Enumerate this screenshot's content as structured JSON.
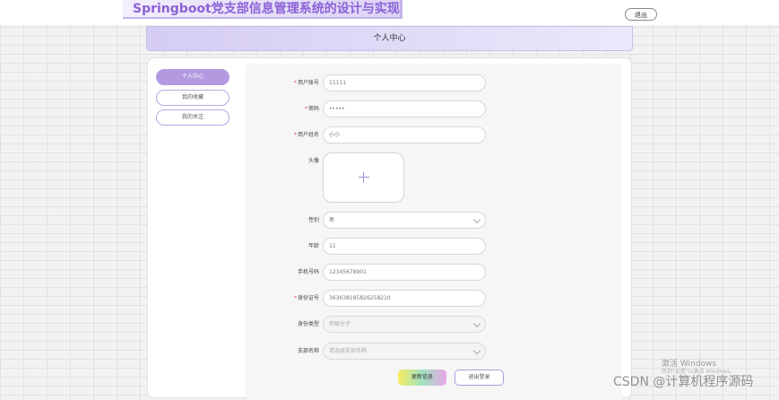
{
  "app": {
    "title": "Springboot党支部信息管理系统的设计与实现",
    "logout": "退出"
  },
  "page": {
    "title": "个人中心"
  },
  "menu": {
    "items": [
      {
        "label": "个人中心",
        "active": true
      },
      {
        "label": "我的收藏",
        "active": false
      },
      {
        "label": "我的关注",
        "active": false
      }
    ]
  },
  "form": {
    "username": {
      "label": "用户账号",
      "required": true,
      "value": "11111"
    },
    "password": {
      "label": "密码",
      "required": true,
      "value": "•••••"
    },
    "fullname": {
      "label": "用户姓名",
      "required": true,
      "value": "小小"
    },
    "avatar": {
      "label": "头像"
    },
    "gender": {
      "label": "性别",
      "value": "男"
    },
    "age": {
      "label": "年龄",
      "value": "11"
    },
    "phone": {
      "label": "手机号码",
      "value": "12345678901"
    },
    "idcard": {
      "label": "身份证号",
      "required": true,
      "value": "363638185826258210"
    },
    "identity": {
      "label": "身份类型",
      "value": "积极分子"
    },
    "branch": {
      "label": "支部名称",
      "placeholder": "请选择支部名称"
    }
  },
  "buttons": {
    "update": "更新信息",
    "logout": "退出登录"
  },
  "overlay": {
    "activate_title": "激活 Windows",
    "activate_sub": "转到\"设置\"以激活 Windows。",
    "watermark": "CSDN @计算机程序源码"
  },
  "colors": {
    "accent": "#b39ae0",
    "required": "#e14b4b",
    "title": "#8a62d6"
  }
}
